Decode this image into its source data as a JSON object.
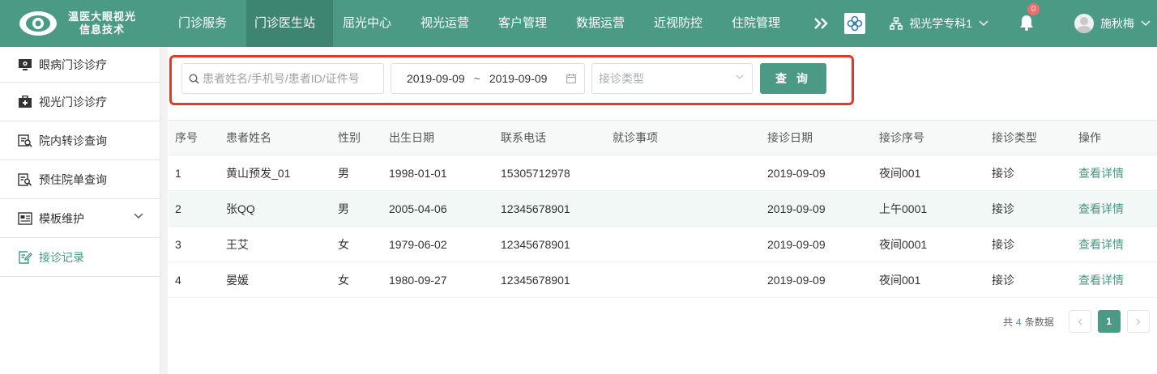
{
  "brand": {
    "line1": "温医大眼视光",
    "line2": "信息技术",
    "accent": "#4a9a86"
  },
  "nav": {
    "items": [
      "门诊服务",
      "门诊医生站",
      "屈光中心",
      "视光运营",
      "客户管理",
      "数据运营",
      "近视防控",
      "住院管理"
    ],
    "active_index": 1,
    "more_icon": "double-chevron-right-icon"
  },
  "header_right": {
    "dept": "视光学专科1",
    "notifications": "0",
    "user": "施秋梅"
  },
  "sidebar": {
    "items": [
      {
        "label": "眼病门诊诊疗",
        "icon": "monitor-icon"
      },
      {
        "label": "视光门诊诊疗",
        "icon": "medical-kit-icon"
      },
      {
        "label": "院内转诊查询",
        "icon": "transfer-search-icon"
      },
      {
        "label": "预住院单查询",
        "icon": "document-search-icon"
      },
      {
        "label": "模板维护",
        "icon": "template-icon"
      },
      {
        "label": "接诊记录",
        "icon": "edit-record-icon"
      }
    ],
    "active_index": 5
  },
  "search": {
    "placeholder": "患者姓名/手机号/患者ID/证件号",
    "date_from": "2019-09-09",
    "date_sep": "~",
    "date_to": "2019-09-09",
    "type_placeholder": "接诊类型",
    "query_label": "查 询"
  },
  "table": {
    "columns": [
      "序号",
      "患者姓名",
      "性别",
      "出生日期",
      "联系电话",
      "就诊事项",
      "接诊日期",
      "接诊序号",
      "接诊类型",
      "操作"
    ],
    "rows": [
      [
        "1",
        "黄山预发_01",
        "男",
        "1998-01-01",
        "15305712978",
        "",
        "2019-09-09",
        "夜间001",
        "接诊",
        "查看详情"
      ],
      [
        "2",
        "张QQ",
        "男",
        "2005-04-06",
        "12345678901",
        "",
        "2019-09-09",
        "上午0001",
        "接诊",
        "查看详情"
      ],
      [
        "3",
        "王艾",
        "女",
        "1979-06-02",
        "12345678901",
        "",
        "2019-09-09",
        "夜间0001",
        "接诊",
        "查看详情"
      ],
      [
        "4",
        "晏媛",
        "女",
        "1980-09-27",
        "12345678901",
        "",
        "2019-09-09",
        "夜间001",
        "接诊",
        "查看详情"
      ]
    ]
  },
  "pagination": {
    "prefix": "共",
    "total": "4",
    "suffix": "条数据",
    "current": "1"
  }
}
